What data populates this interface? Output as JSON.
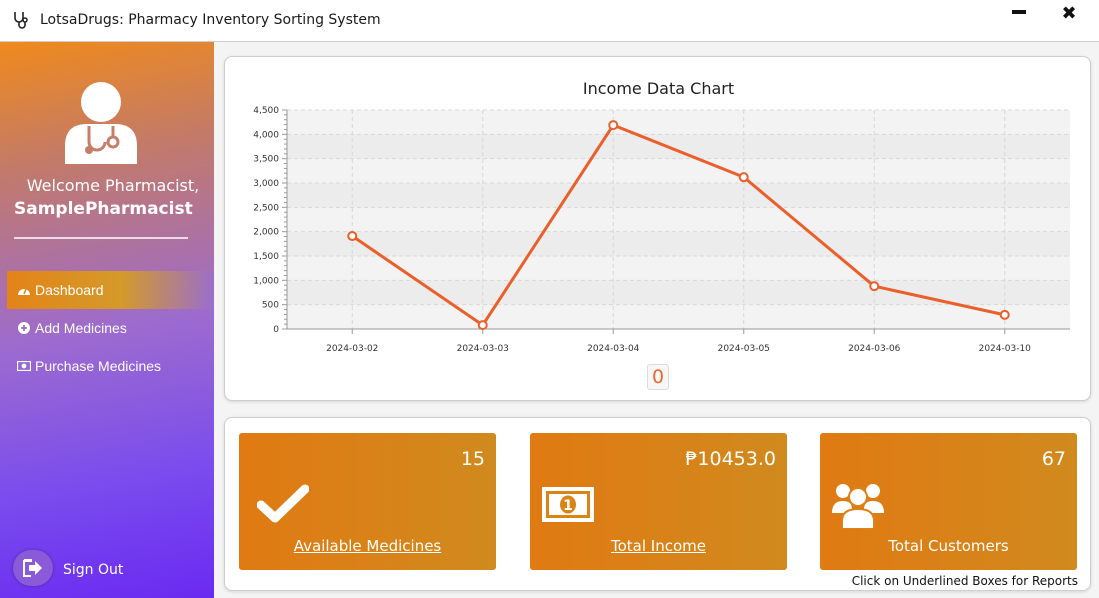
{
  "window": {
    "title": "LotsaDrugs: Pharmacy Inventory Sorting System",
    "close_glyph": "✖"
  },
  "sidebar": {
    "welcome": "Welcome Pharmacist,",
    "username": "SamplePharmacist",
    "items": [
      {
        "label": "Dashboard",
        "icon": "dashboard-icon",
        "active": true
      },
      {
        "label": "Add Medicines",
        "icon": "plus-circle-icon",
        "active": false
      },
      {
        "label": "Purchase Medicines",
        "icon": "money-icon",
        "active": false
      }
    ],
    "signout_label": "Sign Out"
  },
  "chart_card": {
    "title": "Income Data Chart",
    "counter": "0"
  },
  "chart_data": {
    "type": "line",
    "title": "Income Data Chart",
    "categories": [
      "2024-03-02",
      "2024-03-03",
      "2024-03-04",
      "2024-03-05",
      "2024-03-06",
      "2024-03-10"
    ],
    "values": [
      1910,
      80,
      4190,
      3120,
      880,
      290
    ],
    "yticks": [
      "0",
      "500",
      "1,000",
      "1,500",
      "2,000",
      "2,500",
      "3,000",
      "3,500",
      "4,000",
      "4,500"
    ],
    "ylim": [
      0,
      4500
    ],
    "grid": true,
    "line_color": "#ea5f2a"
  },
  "stats": [
    {
      "value": "15",
      "label": "Available Medicines",
      "icon": "checkmark-icon",
      "underlined": true
    },
    {
      "value": "₱10453.0",
      "label": "Total Income",
      "icon": "money-bill-icon",
      "underlined": true
    },
    {
      "value": "67",
      "label": "Total Customers",
      "icon": "users-icon",
      "underlined": false
    }
  ],
  "hint": "Click on Underlined Boxes for Reports",
  "colors": {
    "accent_orange": "#e07a12",
    "sidebar_purple": "#6a2af0"
  }
}
